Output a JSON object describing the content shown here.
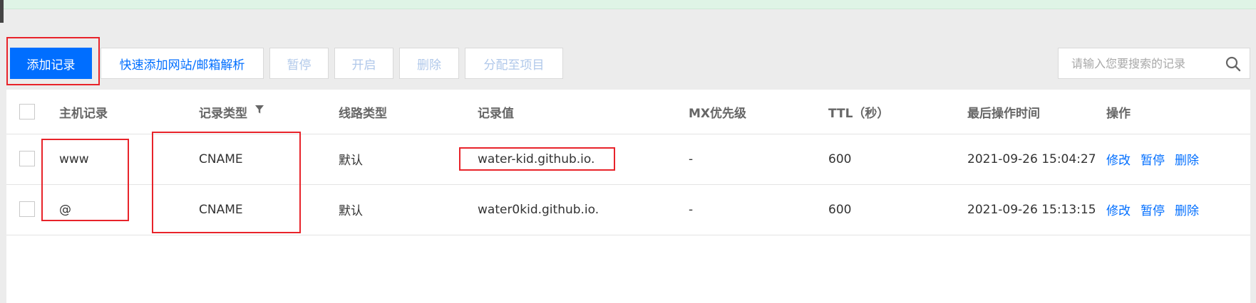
{
  "toolbar": {
    "add_record": "添加记录",
    "quick_add": "快速添加网站/邮箱解析",
    "pause": "暂停",
    "open": "开启",
    "delete": "删除",
    "assign": "分配至项目"
  },
  "search": {
    "placeholder": "请输入您要搜索的记录",
    "value": "",
    "icon": "search-icon"
  },
  "table": {
    "headers": {
      "host": "主机记录",
      "type": "记录类型",
      "line": "线路类型",
      "value": "记录值",
      "mx": "MX优先级",
      "ttl": "TTL（秒）",
      "time": "最后操作时间",
      "ops": "操作"
    },
    "rows": [
      {
        "host": "www",
        "type": "CNAME",
        "line": "默认",
        "value": "water-kid.github.io.",
        "mx": "-",
        "ttl": "600",
        "time": "2021-09-26 15:04:27",
        "edit": "修改",
        "pause": "暂停",
        "delete": "删除"
      },
      {
        "host": "@",
        "type": "CNAME",
        "line": "默认",
        "value": "water0kid.github.io.",
        "mx": "-",
        "ttl": "600",
        "time": "2021-09-26 15:13:15",
        "edit": "修改",
        "pause": "暂停",
        "delete": "删除"
      }
    ]
  },
  "colors": {
    "primary": "#006eff",
    "annotation": "#e8232a",
    "banner": "#dff4e6",
    "background": "#ececec"
  }
}
